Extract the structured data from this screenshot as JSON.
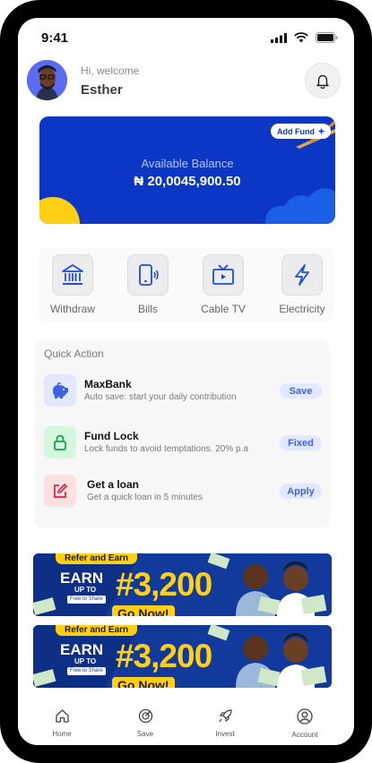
{
  "status_bar": {
    "time": "9:41",
    "icons": [
      "signal-icon",
      "wifi-icon",
      "battery-icon"
    ]
  },
  "header": {
    "greeting": "Hi, welcome",
    "user_name": "Esther",
    "avatar": "avatar-icon",
    "notification_icon": "bell-icon"
  },
  "balance": {
    "label": "Available Balance",
    "value": "₦ 20,0045,900.50",
    "add_fund_label": "Add Fund",
    "add_fund_icon": "plus-icon",
    "card_color": "#0b37c4",
    "accent_color": "#ffcf14"
  },
  "services": [
    {
      "label": "Withdraw",
      "icon": "bank-icon"
    },
    {
      "label": "Bills",
      "icon": "phone-icon"
    },
    {
      "label": "Cable TV",
      "icon": "tv-icon"
    },
    {
      "label": "Electricity",
      "icon": "lightning-icon"
    }
  ],
  "quick_action": {
    "title": "Quick Action",
    "items": [
      {
        "title": "MaxBank",
        "subtitle": "Auto save: start your daily contribution",
        "button": "Save",
        "icon": "piggy-bank-icon",
        "color": "#e1e8ff"
      },
      {
        "title": "Fund Lock",
        "subtitle": "Lock funds to avoid temptations. 20% p.a",
        "button": "Fixed",
        "icon": "lock-icon",
        "color": "#d4f7dd"
      },
      {
        "title": "Get  a  loan",
        "subtitle": "Get a quick loan in 5 minutes",
        "button": "Apply",
        "icon": "edit-icon",
        "color": "#fde0e0"
      }
    ]
  },
  "banners": [
    {
      "tag": "Refer and Earn",
      "earn": "EARN",
      "up_to": "UP TO",
      "free": "Free to Share",
      "amount": "#3,200",
      "cta": "Go Now!"
    },
    {
      "tag": "Refer and Earn",
      "earn": "EARN",
      "up_to": "UP TO",
      "free": "Free to Share",
      "amount": "#3,200",
      "cta": "Go Now!"
    }
  ],
  "tabbar": [
    {
      "label": "Home",
      "icon": "home-icon"
    },
    {
      "label": "Save",
      "icon": "target-icon"
    },
    {
      "label": "Invest",
      "icon": "rocket-icon"
    },
    {
      "label": "Account",
      "icon": "user-icon"
    }
  ]
}
